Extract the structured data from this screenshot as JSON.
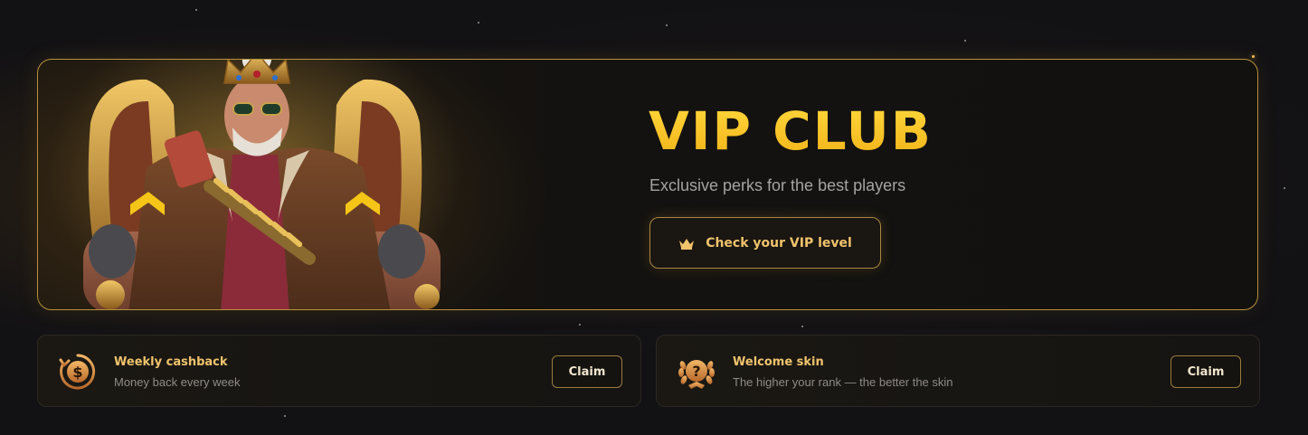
{
  "hero": {
    "title": "VIP CLUB",
    "subtitle": "Exclusive perks for the best players",
    "button_label": "Check your VIP level",
    "button_icon": "crown-icon",
    "art": "king-on-throne-illustration"
  },
  "perks": [
    {
      "icon": "dollar-cashback-icon",
      "title": "Weekly cashback",
      "description": "Money back every week",
      "action_label": "Claim"
    },
    {
      "icon": "laurel-question-icon",
      "title": "Welcome skin",
      "description": "The higher your rank — the better the skin",
      "action_label": "Claim"
    }
  ],
  "colors": {
    "accent_gold": "#f6c21c",
    "border_gold": "#b8913a",
    "text_gold": "#f0c36c",
    "background": "#121114"
  }
}
